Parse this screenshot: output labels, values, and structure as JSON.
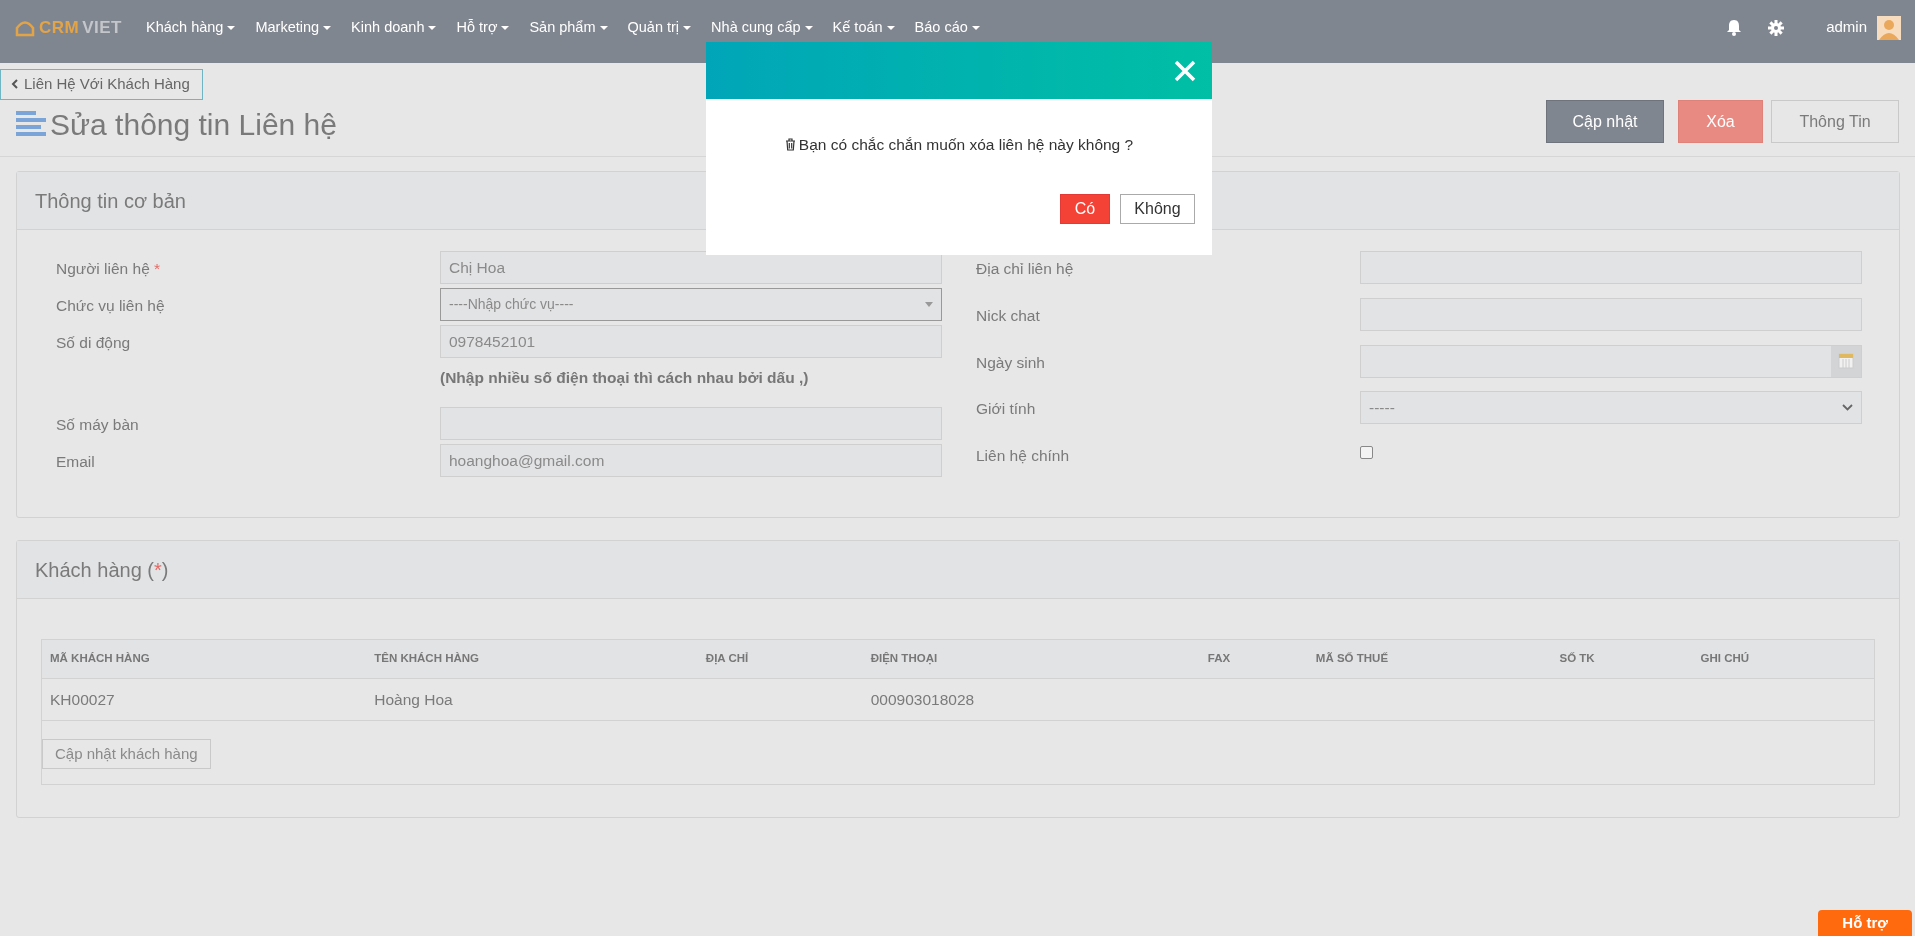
{
  "navbar": {
    "logo": {
      "part_1": "CRM",
      "part_2": "VIET"
    },
    "menus": [
      {
        "label": "Khách hàng",
        "has_caret": true
      },
      {
        "label": "Marketing",
        "has_caret": true
      },
      {
        "label": "Kinh doanh",
        "has_caret": true
      },
      {
        "label": "Hỗ trợ",
        "has_caret": true
      },
      {
        "label": "Sản phẩm",
        "has_caret": true
      },
      {
        "label": "Quản trị",
        "has_caret": true
      },
      {
        "label": "Nhà cung cấp",
        "has_caret": true
      },
      {
        "label": "Kế toán",
        "has_caret": true
      },
      {
        "label": "Báo cáo",
        "has_caret": true
      }
    ],
    "user": "admin"
  },
  "back_link": "Liên Hệ Với Khách Hàng",
  "page_title": "Sửa thông tin Liên hệ",
  "actions": [
    {
      "label": "Cập nhật",
      "kind": "primary"
    },
    {
      "label": "Xóa",
      "kind": "danger"
    },
    {
      "label": "Thông Tin",
      "kind": "default"
    }
  ],
  "basic_info": {
    "title": "Thông tin cơ bản",
    "left_fields": [
      {
        "label": "Người liên hệ",
        "required_mark": "*",
        "kind": "text",
        "value": "Chị Hoa"
      },
      {
        "label": "Chức vụ liên hệ",
        "kind": "select",
        "value": "----Nhập chức vụ----"
      },
      {
        "label": "Số di động",
        "kind": "text",
        "value": "0978452101",
        "help": "(Nhập nhiều số điện thoại thì cách nhau bởi dấu ,)"
      },
      {
        "label": "Số máy bàn",
        "kind": "text"
      },
      {
        "label": "Email",
        "kind": "text",
        "value": "hoanghoa@gmail.com"
      }
    ],
    "right_fields": [
      {
        "label": "Địa chỉ liên hệ",
        "kind": "text"
      },
      {
        "label": "Nick chat",
        "kind": "text"
      },
      {
        "label": "Ngày sinh",
        "kind": "date"
      },
      {
        "label": "Giới tính",
        "kind": "select2",
        "value": "-----"
      },
      {
        "label": "Liên hệ chính",
        "kind": "checkbox",
        "checked": false
      }
    ]
  },
  "customers": {
    "title": "Khách hàng",
    "required_note": {
      "open": "(",
      "mark": "*",
      "close": ")"
    },
    "columns": [
      "MÃ KHÁCH HÀNG",
      "TÊN KHÁCH HÀNG",
      "ĐỊA CHỈ",
      "ĐIỆN THOẠI",
      "FAX",
      "MÃ SỐ THUẾ",
      "SỐ TK",
      "GHI CHÚ"
    ],
    "rows": [
      [
        "KH00027",
        "Hoàng Hoa",
        null,
        "000903018028",
        null,
        null,
        null,
        null
      ]
    ],
    "button": "Cập nhật khách hàng"
  },
  "modal": {
    "message": "Bạn có chắc chắn muốn xóa liên hệ này không ?",
    "buttons": [
      {
        "label": "Có",
        "kind": "danger"
      },
      {
        "label": "Không",
        "kind": "default"
      }
    ]
  },
  "help_button": "Hỗ trợ"
}
